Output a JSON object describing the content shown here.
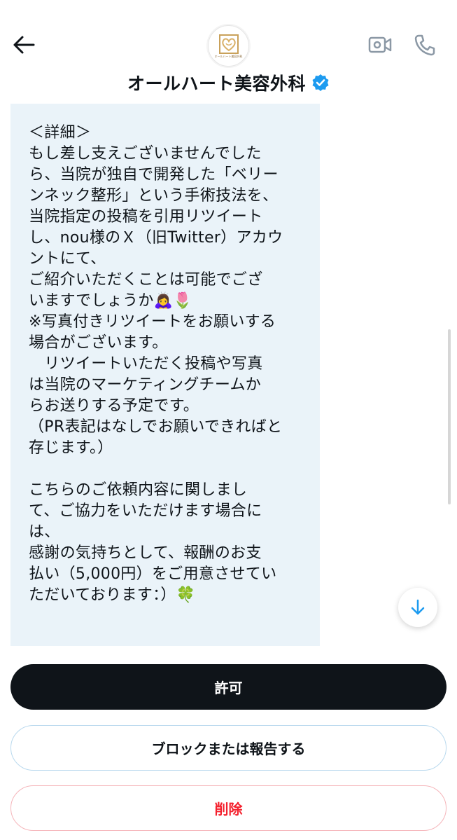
{
  "header": {
    "title": "オールハート美容外科",
    "avatar_logo_text": "オールハート美容外科",
    "back_icon": "arrow-left-icon",
    "video_icon": "video-camera-icon",
    "call_icon": "phone-icon",
    "verified_icon": "verified-badge-icon"
  },
  "message": {
    "text": "＜詳細＞\nもし差し支えございませんでした\nら、当院が独自で開発した「ベリー\nンネック整形」という手術技法を、\n当院指定の投稿を引用リツイート\nし、nou様のＸ（旧Twitter）アカウ\nントにて、\nご紹介いただくことは可能でござ\nいますでしょうか🙇‍♀️🌷\n※写真付きリツイートをお願いする\n場合がございます。\n　リツイートいただく投稿や写真\nは当院のマーケティングチームか\nらお送りする予定です。\n（PR表記はなしでお願いできればと\n存じます。）\n\nこちらのご依頼内容に関しまし\nて、ご協力をいただけます場合に\nは、\n感謝の気持ちとして、報酬のお支\n払い（5,000円）をご用意させてい\nただいております：）🍀"
  },
  "actions": {
    "allow_label": "許可",
    "block_label": "ブロックまたは報告する",
    "delete_label": "削除"
  },
  "colors": {
    "bubble_bg": "#eaf3f9",
    "primary_button_bg": "#0f1419",
    "verified_blue": "#1d9bf0",
    "delete_red": "#f4212e",
    "icon_gray": "#8b98a5"
  }
}
